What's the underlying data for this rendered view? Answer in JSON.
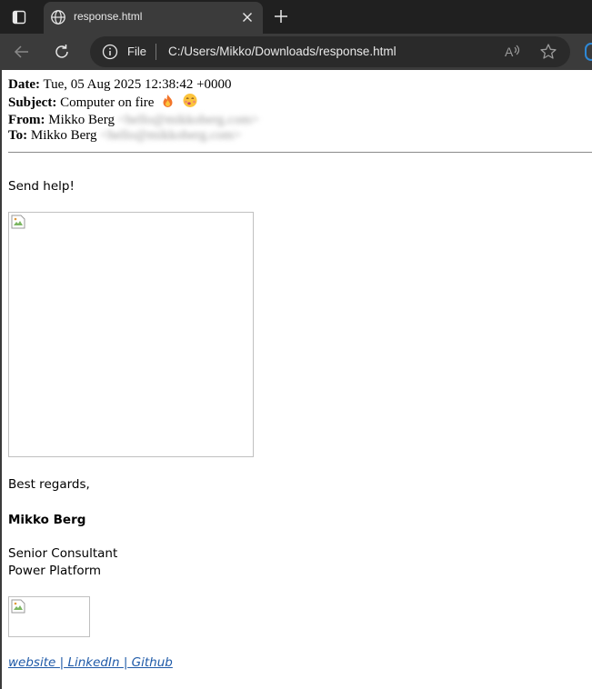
{
  "tab": {
    "title": "response.html"
  },
  "address_bar": {
    "scheme_label": "File",
    "url": "C:/Users/Mikko/Downloads/response.html"
  },
  "email": {
    "date_label": "Date:",
    "date_value": "Tue, 05 Aug 2025 12:38:42 +0000",
    "subject_label": "Subject:",
    "subject_value": "Computer on fire",
    "subject_emojis": [
      "fire-emoji",
      "face-exhaling-emoji"
    ],
    "from_label": "From:",
    "from_name": "Mikko Berg",
    "from_email_blurred": "<hello@mikkoberg.com>",
    "to_label": "To:",
    "to_name": "Mikko Berg",
    "to_email_blurred": "<hello@mikkoberg.com>"
  },
  "body": {
    "greeting": "Send help!",
    "closing": "Best regards,",
    "signature_name": "Mikko Berg",
    "signature_title": "Senior Consultant",
    "signature_dept": "Power Platform",
    "links": [
      {
        "label": "website "
      },
      {
        "label": " LinkedIn "
      },
      {
        "label": " Github"
      }
    ],
    "link_separator": "|"
  },
  "colors": {
    "link": "#1f5aa8",
    "chrome_dark": "#202020",
    "chrome_mid": "#3b3b3b"
  }
}
